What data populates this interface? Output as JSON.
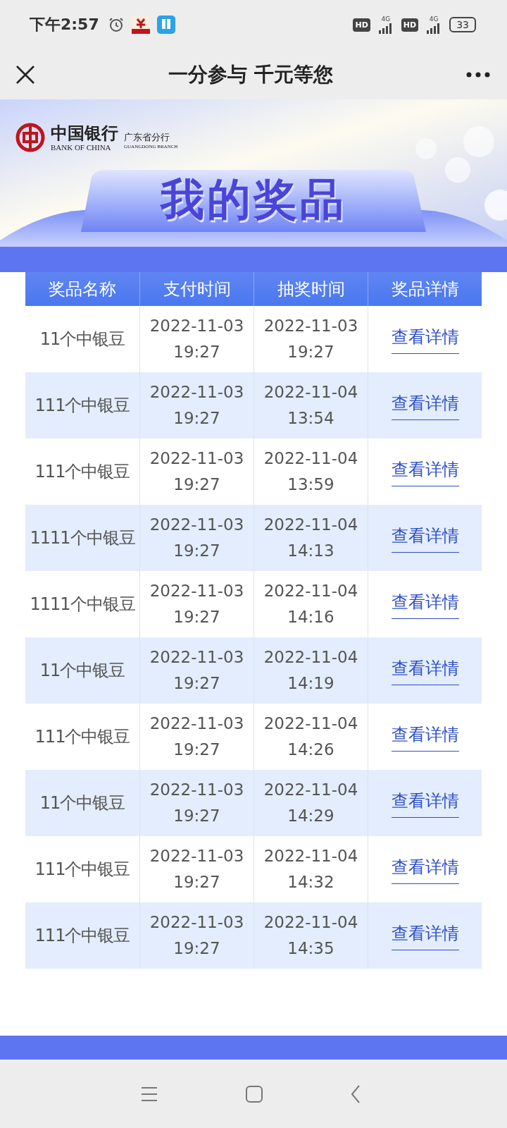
{
  "status_bar": {
    "time": "下午2:57",
    "sim_labels": [
      {
        "hd": "HD",
        "network": "4G"
      },
      {
        "hd": "HD",
        "network": "4G"
      }
    ],
    "battery": "33"
  },
  "title_bar": {
    "title": "一分参与 千元等您"
  },
  "banner": {
    "bank_name": "中国银行",
    "bank_name_en": "BANK OF CHINA",
    "branch": "广东省分行",
    "branch_en": "GUANGDONG BRANCH",
    "heading": "我的奖品"
  },
  "table": {
    "columns": [
      "奖品名称",
      "支付时间",
      "抽奖时间",
      "奖品详情"
    ],
    "rows": [
      {
        "prize": "11个中银豆",
        "paid": [
          "2022-11-03",
          "19:27"
        ],
        "drawn": [
          "2022-11-03",
          "19:27"
        ],
        "link": "查看详情"
      },
      {
        "prize": "111个中银豆",
        "paid": [
          "2022-11-03",
          "19:27"
        ],
        "drawn": [
          "2022-11-04",
          "13:54"
        ],
        "link": "查看详情"
      },
      {
        "prize": "111个中银豆",
        "paid": [
          "2022-11-03",
          "19:27"
        ],
        "drawn": [
          "2022-11-04",
          "13:59"
        ],
        "link": "查看详情"
      },
      {
        "prize": "1111个中银豆",
        "paid": [
          "2022-11-03",
          "19:27"
        ],
        "drawn": [
          "2022-11-04",
          "14:13"
        ],
        "link": "查看详情"
      },
      {
        "prize": "1111个中银豆",
        "paid": [
          "2022-11-03",
          "19:27"
        ],
        "drawn": [
          "2022-11-04",
          "14:16"
        ],
        "link": "查看详情"
      },
      {
        "prize": "11个中银豆",
        "paid": [
          "2022-11-03",
          "19:27"
        ],
        "drawn": [
          "2022-11-04",
          "14:19"
        ],
        "link": "查看详情"
      },
      {
        "prize": "111个中银豆",
        "paid": [
          "2022-11-03",
          "19:27"
        ],
        "drawn": [
          "2022-11-04",
          "14:26"
        ],
        "link": "查看详情"
      },
      {
        "prize": "11个中银豆",
        "paid": [
          "2022-11-03",
          "19:27"
        ],
        "drawn": [
          "2022-11-04",
          "14:29"
        ],
        "link": "查看详情"
      },
      {
        "prize": "111个中银豆",
        "paid": [
          "2022-11-03",
          "19:27"
        ],
        "drawn": [
          "2022-11-04",
          "14:32"
        ],
        "link": "查看详情"
      },
      {
        "prize": "111个中银豆",
        "paid": [
          "2022-11-03",
          "19:27"
        ],
        "drawn": [
          "2022-11-04",
          "14:35"
        ],
        "link": "查看详情"
      }
    ]
  }
}
